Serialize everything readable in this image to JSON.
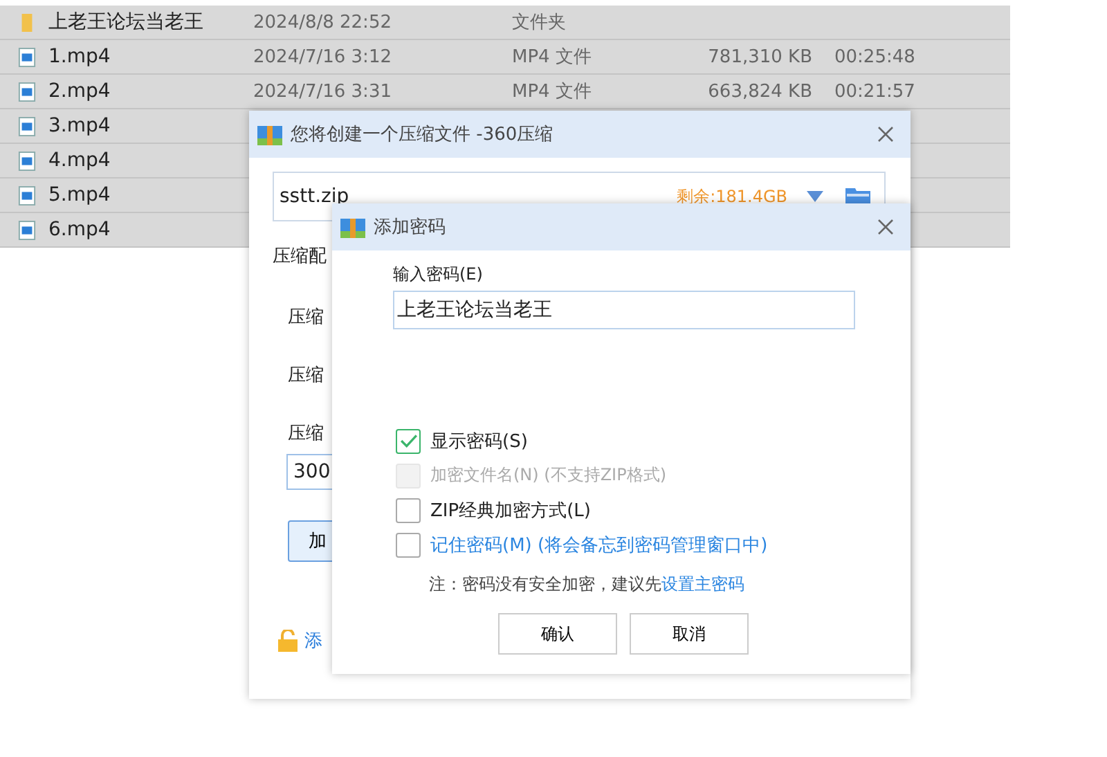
{
  "files": [
    {
      "kind": "folder",
      "name": "上老王论坛当老王",
      "date": "2024/8/8 22:52",
      "type": "文件夹"
    },
    {
      "kind": "video",
      "name": "1.mp4",
      "date": "2024/7/16 3:12",
      "type": "MP4 文件",
      "size": "781,310 KB",
      "duration": "00:25:48"
    },
    {
      "kind": "video",
      "name": "2.mp4",
      "date": "2024/7/16 3:31",
      "type": "MP4 文件",
      "size": "663,824 KB",
      "duration": "00:21:57"
    },
    {
      "kind": "video",
      "name": "3.mp4"
    },
    {
      "kind": "video",
      "name": "4.mp4"
    },
    {
      "kind": "video",
      "name": "5.mp4"
    },
    {
      "kind": "video",
      "name": "6.mp4"
    }
  ],
  "compress_dialog": {
    "title": "您将创建一个压缩文件 -360压缩",
    "filename": "sstt.zip",
    "free_space": "剩余:181.4GB",
    "section_label": "压缩配",
    "option_labels": [
      "压缩",
      "压缩",
      "压缩"
    ],
    "split_value": "300",
    "button": "加",
    "link": "添"
  },
  "password_dialog": {
    "title": "添加密码",
    "password_label": "输入密码(E)",
    "password": "上老王论坛当老王",
    "options": [
      {
        "label": "显示密码(S)",
        "checked": true,
        "disabled": false,
        "link": false
      },
      {
        "label": "加密文件名(N) (不支持ZIP格式)",
        "checked": false,
        "disabled": true,
        "link": false
      },
      {
        "label": "ZIP经典加密方式(L)",
        "checked": false,
        "disabled": false,
        "link": false
      },
      {
        "label": "记住密码(M) (将会备忘到密码管理窗口中)",
        "checked": false,
        "disabled": false,
        "link": true
      }
    ],
    "note": "注：密码没有安全加密，建议先",
    "note_link": "设置主密码",
    "buttons": [
      "确认",
      "取消"
    ]
  }
}
